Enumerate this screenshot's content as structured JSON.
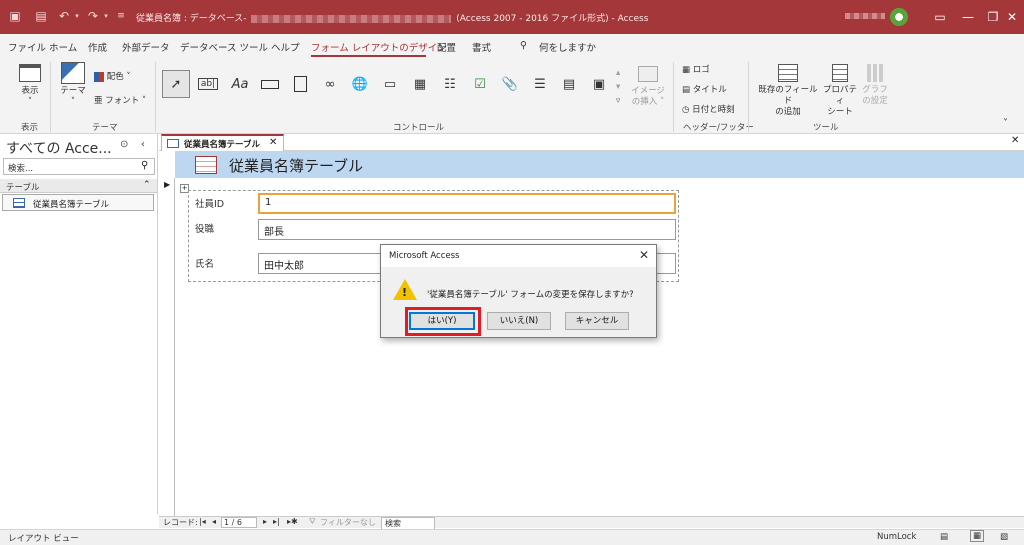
{
  "window": {
    "title_prefix": "従業員名簿 : データベース- ",
    "title_suffix": " (Access 2007 - 2016 ファイル形式) - Access"
  },
  "menu": {
    "items": [
      "ファイル",
      "ホーム",
      "作成",
      "外部データ",
      "データベース ツール",
      "ヘルプ",
      "フォーム レイアウトのデザイン",
      "配置",
      "書式"
    ],
    "tell_me": "何をしますか"
  },
  "ribbon": {
    "view_label": "表示",
    "theme_label": "テーマ",
    "colors_label": "配色",
    "fonts_label": "フォント",
    "image_insert_line1": "イメージ",
    "image_insert_line2": "の挿入",
    "logo_label": "ロゴ",
    "title_label": "タイトル",
    "datetime_label": "日付と時刻",
    "existing_fields_line1": "既存のフィールド",
    "existing_fields_line2": "の追加",
    "property_line1": "プロパティ",
    "property_line2": "シート",
    "chart_line1": "グラフ",
    "chart_line2": "の設定",
    "groups": {
      "view": "表示",
      "theme": "テーマ",
      "controls": "コントロール",
      "header_footer": "ヘッダー/フッター",
      "tools": "ツール"
    }
  },
  "nav_pane": {
    "title": "すべての Acce...",
    "search_placeholder": "検索...",
    "group": "テーブル",
    "objects": [
      "従業員名簿テーブル"
    ]
  },
  "document": {
    "tab_label": "従業員名簿テーブル",
    "form_title": "従業員名簿テーブル",
    "fields": [
      {
        "label": "社員ID",
        "value": "1"
      },
      {
        "label": "役職",
        "value": "部長"
      },
      {
        "label": "氏名",
        "value": "田中太郎"
      }
    ]
  },
  "record_nav": {
    "label": "レコード:",
    "position": "1 / 6",
    "filter": "フィルターなし",
    "search": "検索"
  },
  "status": {
    "mode": "レイアウト ビュー",
    "numlock": "NumLock"
  },
  "dialog": {
    "title": "Microsoft Access",
    "message": "'従業員名簿テーブル' フォームの変更を保存しますか?",
    "yes": "はい(Y)",
    "no": "いいえ(N)",
    "cancel": "キャンセル"
  },
  "colors": {
    "accent": "#a4373a",
    "form_header": "#bed7f0",
    "highlight": "#e11c24"
  }
}
